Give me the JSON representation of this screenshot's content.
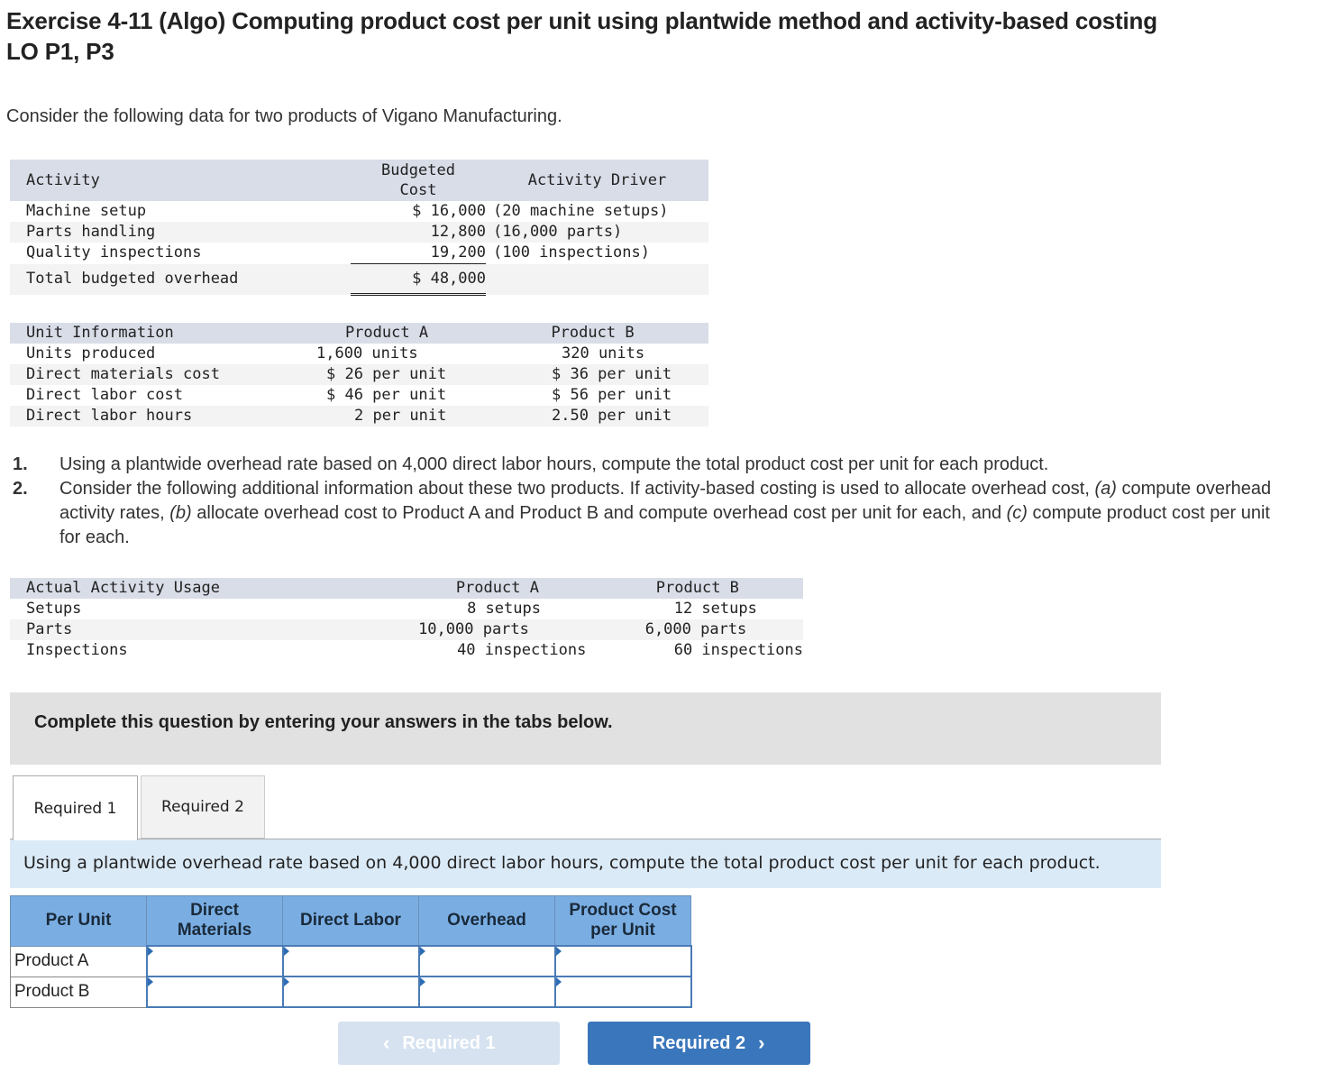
{
  "title": {
    "line1": "Exercise 4-11 (Algo) Computing product cost per unit using plantwide method and activity-based costing",
    "line2": "LO P1, P3"
  },
  "intro": "Consider the following data for two products of Vigano Manufacturing.",
  "activity_table": {
    "headers": [
      "Activity",
      "Budgeted",
      "Cost",
      "Activity Driver"
    ],
    "rows": [
      {
        "activity": "Machine setup",
        "cost": "$ 16,000",
        "driver": "(20 machine setups)"
      },
      {
        "activity": "Parts handling",
        "cost": "12,800",
        "driver": "(16,000 parts)"
      },
      {
        "activity": "Quality inspections",
        "cost": "19,200",
        "driver": "(100 inspections)"
      }
    ],
    "total": {
      "label": "Total budgeted overhead",
      "cost": "$ 48,000"
    }
  },
  "unit_table": {
    "headers": [
      "Unit Information",
      "Product A",
      "Product B"
    ],
    "rows": [
      {
        "label": "Units produced",
        "a": "1,600 units",
        "b": "320 units"
      },
      {
        "label": "Direct materials cost",
        "a": "$ 26 per unit",
        "b": "$ 36 per unit"
      },
      {
        "label": "Direct labor cost",
        "a": "$ 46 per unit",
        "b": "$ 56 per unit"
      },
      {
        "label": "Direct labor hours",
        "a": "2 per unit",
        "b": "2.50 per unit"
      }
    ]
  },
  "questions": [
    {
      "num": "1.",
      "text": "Using a plantwide overhead rate based on 4,000 direct labor hours, compute the total product cost per unit for each product."
    },
    {
      "num": "2.",
      "pre": "Consider the following additional information about these two products. If activity-based costing is used to allocate overhead cost, ",
      "a": "(a)",
      "a_text": " compute overhead activity rates, ",
      "b": "(b)",
      "b_text": " allocate overhead cost to Product A and Product B and compute overhead cost per unit for each, and ",
      "c": "(c)",
      "c_text": " compute product cost per unit for each."
    }
  ],
  "usage_table": {
    "headers": [
      "Actual Activity Usage",
      "Product A",
      "Product B"
    ],
    "rows": [
      {
        "label": "Setups",
        "a": "8 setups",
        "b": "12 setups"
      },
      {
        "label": "Parts",
        "a": "10,000 parts",
        "b": "6,000 parts"
      },
      {
        "label": "Inspections",
        "a": "40 inspections",
        "b": "60 inspections"
      }
    ]
  },
  "banner": "Complete this question by entering your answers in the tabs below.",
  "tabs": [
    {
      "label": "Required 1",
      "active": true
    },
    {
      "label": "Required 2",
      "active": false
    }
  ],
  "instruction": "Using a plantwide overhead rate based on 4,000 direct labor hours, compute the total product cost per unit for each product.",
  "answer_table": {
    "headers": [
      "Per Unit",
      "Direct Materials",
      "Direct Labor",
      "Overhead",
      "Product Cost per Unit"
    ],
    "rows": [
      {
        "label": "Product A",
        "values": [
          "",
          "",
          "",
          ""
        ]
      },
      {
        "label": "Product B",
        "values": [
          "",
          "",
          "",
          ""
        ]
      }
    ]
  },
  "nav": {
    "prev_label": "Required 1",
    "next_label": "Required 2",
    "prev_icon": "chevron-left-icon",
    "next_icon": "chevron-right-icon"
  }
}
